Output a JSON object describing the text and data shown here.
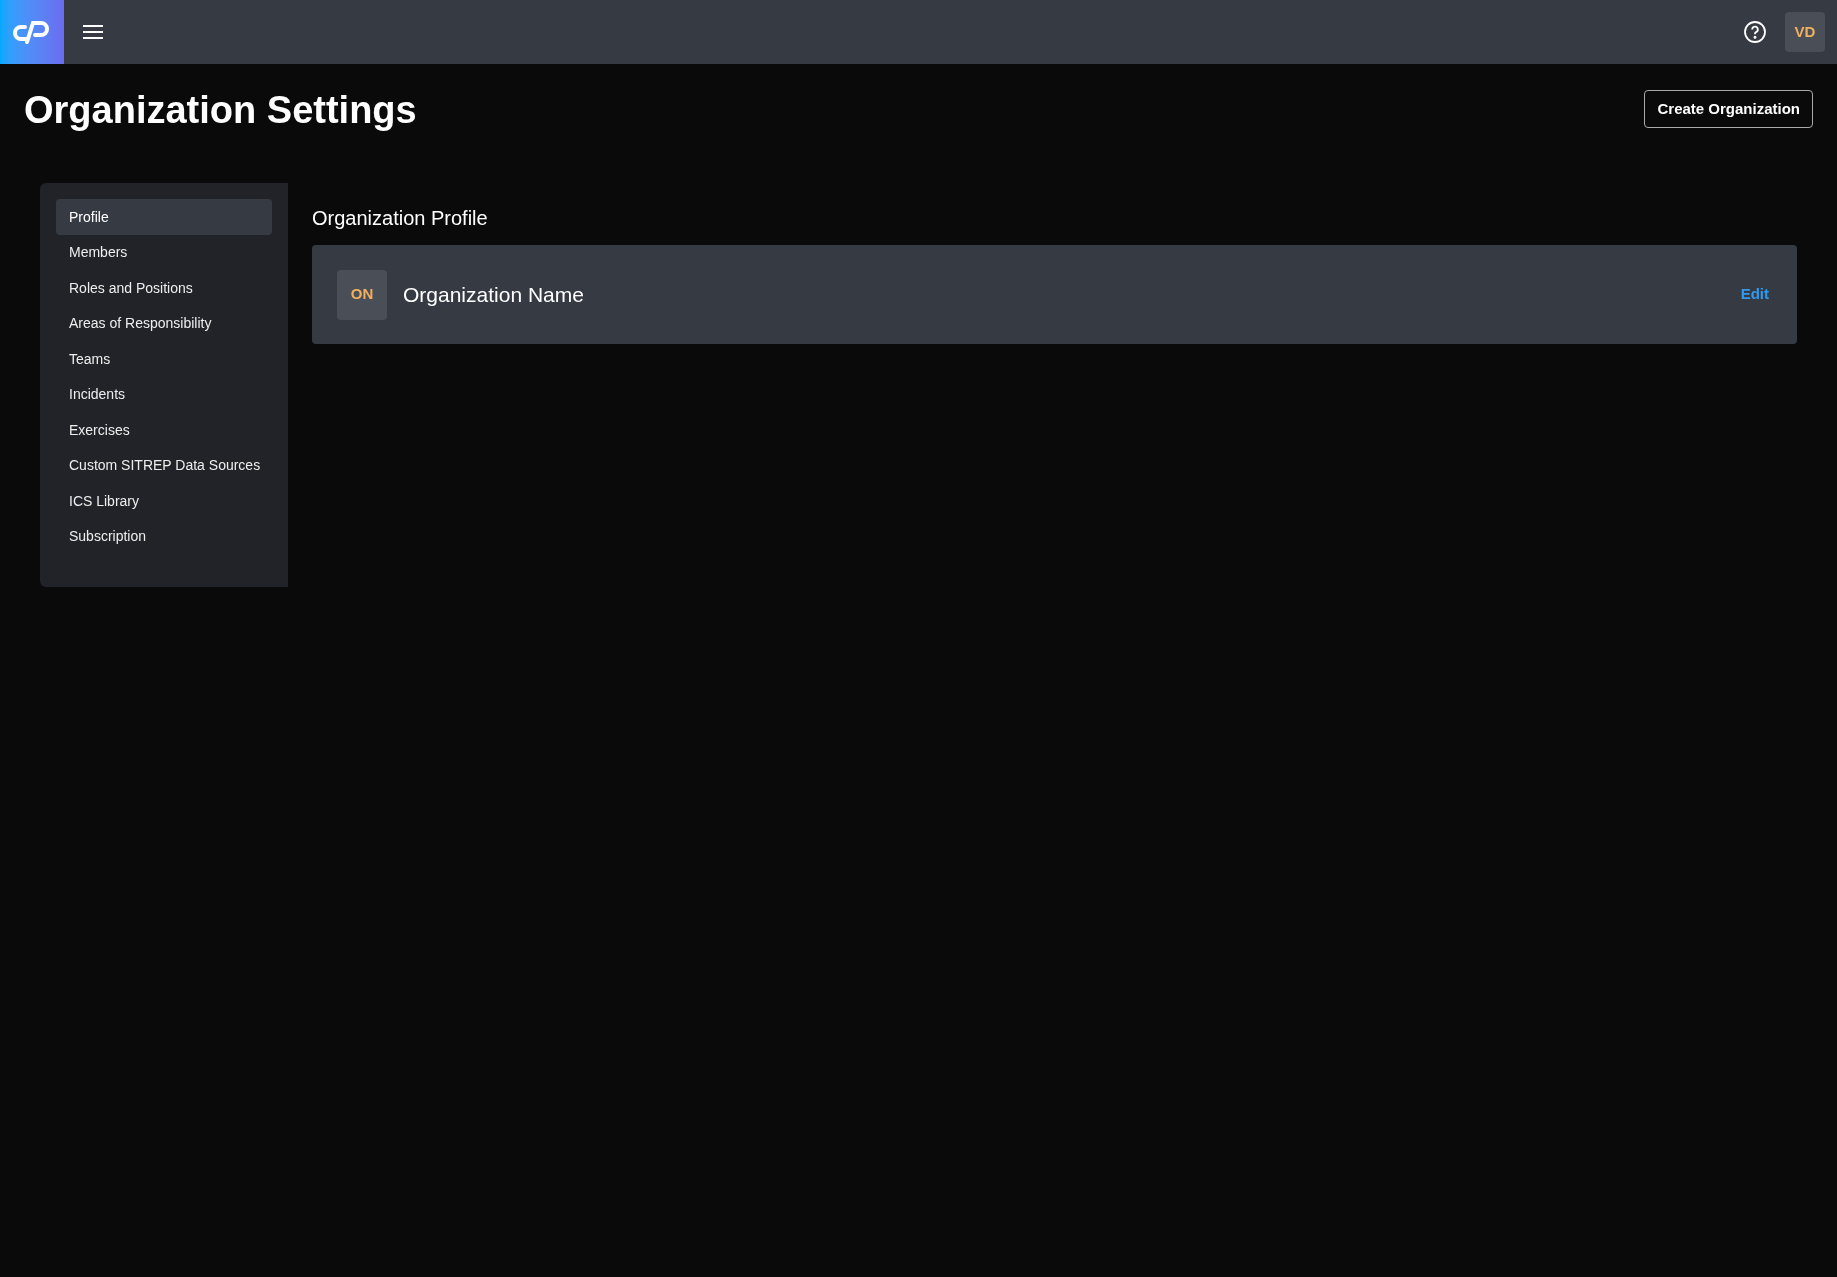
{
  "header": {
    "user_initials": "VD"
  },
  "page": {
    "title": "Organization Settings",
    "action": "Create Organization"
  },
  "sidebar": {
    "items": [
      {
        "label": "Profile",
        "selected": true
      },
      {
        "label": "Members",
        "selected": false
      },
      {
        "label": "Roles and Positions",
        "selected": false
      },
      {
        "label": "Areas of Responsibility",
        "selected": false
      },
      {
        "label": "Teams",
        "selected": false
      },
      {
        "label": "Incidents",
        "selected": false
      },
      {
        "label": "Exercises",
        "selected": false
      },
      {
        "label": "Custom SITREP Data Sources",
        "selected": false
      },
      {
        "label": "ICS Library",
        "selected": false
      },
      {
        "label": "Subscription",
        "selected": false
      }
    ]
  },
  "profile": {
    "heading": "Organization Profile",
    "initials": "ON",
    "name": "Organization Name",
    "edit": "Edit"
  }
}
